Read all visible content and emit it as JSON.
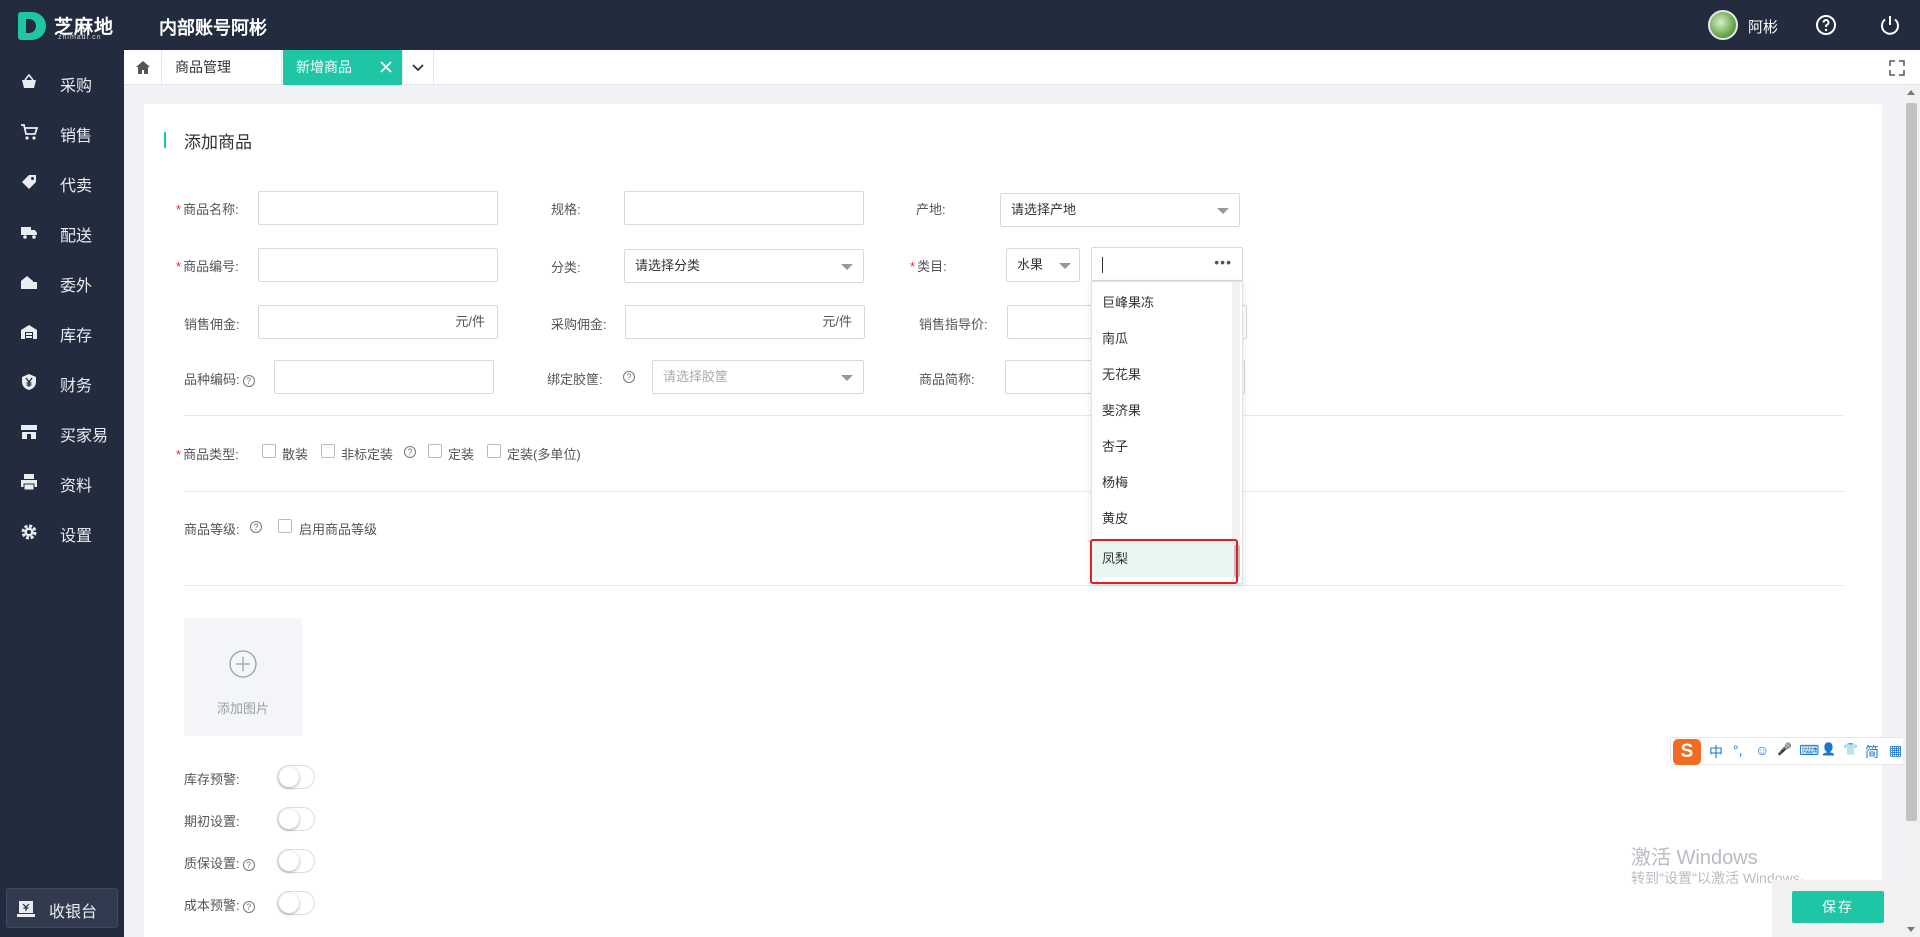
{
  "header": {
    "logo_text": "芝麻地",
    "logo_sub": "zhimadi.cn",
    "title": "内部账号阿彬",
    "user_name": "阿彬"
  },
  "sidebar": {
    "items": [
      {
        "label": "采购",
        "icon": "basket-icon"
      },
      {
        "label": "销售",
        "icon": "cart-icon"
      },
      {
        "label": "代卖",
        "icon": "tag-icon"
      },
      {
        "label": "配送",
        "icon": "truck-icon"
      },
      {
        "label": "委外",
        "icon": "outsource-icon"
      },
      {
        "label": "库存",
        "icon": "warehouse-icon"
      },
      {
        "label": "财务",
        "icon": "yuan-shield-icon"
      },
      {
        "label": "买家易",
        "icon": "store-icon"
      },
      {
        "label": "资料",
        "icon": "printer-icon"
      },
      {
        "label": "设置",
        "icon": "gear-icon"
      }
    ],
    "cashier_label": "收银台"
  },
  "tabs": {
    "items": [
      "商品管理",
      "新增商品"
    ],
    "active": "新增商品"
  },
  "form": {
    "section_title": "添加商品",
    "name_label": "商品名称:",
    "spec_label": "规格:",
    "origin_label": "产地:",
    "origin_placeholder": "请选择产地",
    "code_label": "商品编号:",
    "category_label": "分类:",
    "category_placeholder": "请选择分类",
    "class_label": "类目:",
    "class_value": "水果",
    "sale_comm_label": "销售佣金:",
    "sale_comm_unit": "元/件",
    "buy_comm_label": "采购佣金:",
    "buy_comm_unit": "元/件",
    "guide_price_label": "销售指导价:",
    "variety_code_label": "品种编码:",
    "bind_basket_label": "绑定胶筐:",
    "bind_basket_placeholder": "请选择胶筐",
    "short_name_label": "商品简称:",
    "type_label": "商品类型:",
    "type_options": [
      "散装",
      "非标定装",
      "定装",
      "定装(多单位)"
    ],
    "grade_label": "商品等级:",
    "grade_option": "启用商品等级",
    "add_image_label": "添加图片",
    "stock_warn_label": "库存预警:",
    "initial_label": "期初设置:",
    "warranty_label": "质保设置:",
    "cost_warn_label": "成本预警:",
    "required_mark": "*",
    "help_mark": "?"
  },
  "dropdown": {
    "more_label": "•••",
    "items": [
      "巨峰果冻",
      "南瓜",
      "无花果",
      "斐济果",
      "杏子",
      "杨梅",
      "黄皮",
      "凤梨"
    ],
    "highlighted": "凤梨"
  },
  "ime": {
    "logo": "S",
    "items": [
      "中",
      "°,",
      "☺",
      "🎤",
      "⌨",
      "👤",
      "👕",
      "简",
      "▦"
    ]
  },
  "watermark": {
    "line1": "激活 Windows",
    "line2": "转到\"设置\"以激活 Windows。"
  },
  "actions": {
    "save_label": "保存"
  },
  "colors": {
    "accent": "#1fc6a6",
    "topbar": "#232b3e",
    "highlight_border": "#e02020"
  }
}
